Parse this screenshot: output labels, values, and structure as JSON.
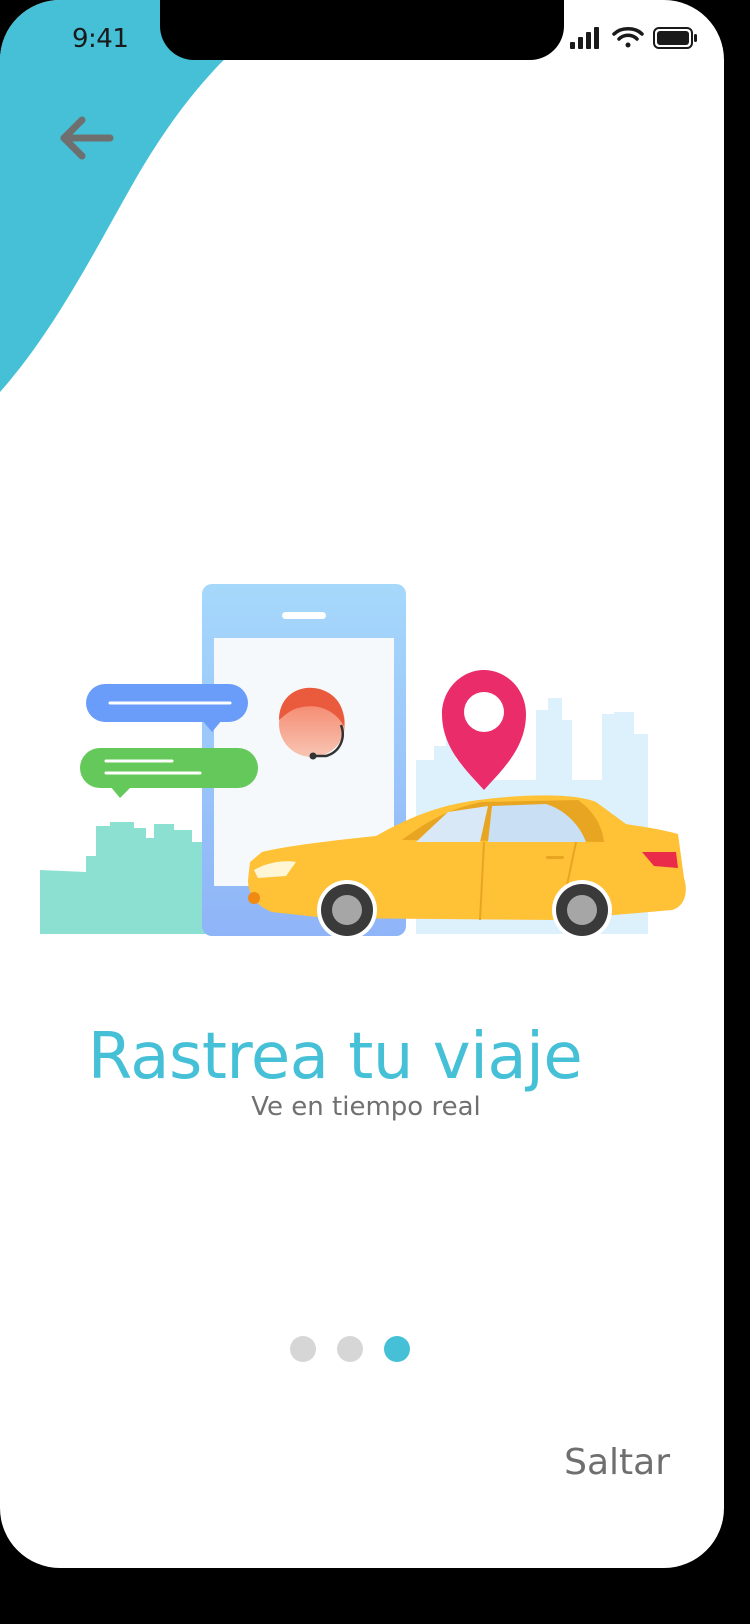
{
  "status_bar": {
    "time": "9:41",
    "icons": [
      "signal-icon",
      "wifi-icon",
      "battery-icon"
    ]
  },
  "header": {
    "back_icon": "arrow-left-icon"
  },
  "illustration": {
    "description_icons": [
      "phone-icon",
      "chat-bubble-icon",
      "support-agent-icon",
      "location-pin-icon",
      "car-icon",
      "city-skyline-icon"
    ]
  },
  "onboarding": {
    "title": "Rastrea tu viaje",
    "subtitle": "Ve en tiempo real"
  },
  "pagination": {
    "total": 3,
    "active_index": 2
  },
  "footer": {
    "skip_label": "Saltar"
  },
  "colors": {
    "accent": "#45c0d6",
    "dot_inactive": "#d6d6d6",
    "text_gray": "#707070",
    "car_yellow": "#ffc136",
    "pin_pink": "#ea2c6a"
  }
}
